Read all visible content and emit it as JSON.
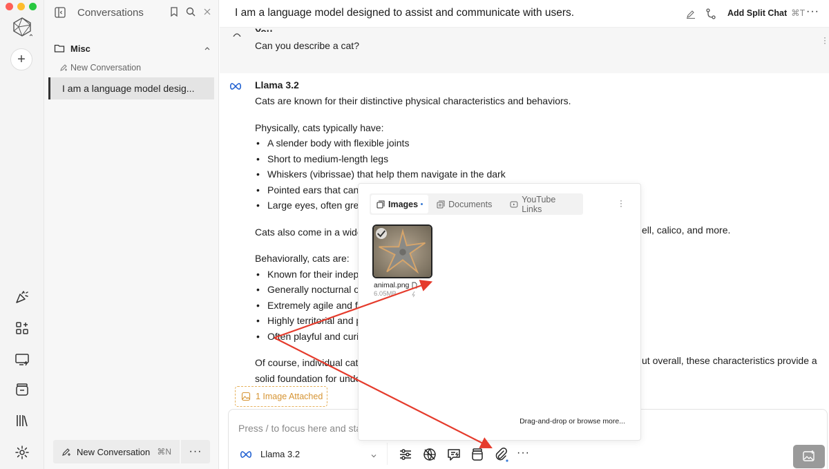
{
  "window": {
    "traffic_colors": [
      "#fe5f57",
      "#febc2e",
      "#28c840"
    ]
  },
  "sidebar": {
    "title": "Conversations",
    "folder": {
      "name": "Misc"
    },
    "new_conversation_link": "New Conversation",
    "conversations": [
      {
        "label": "I am a language model desig..."
      }
    ],
    "footer": {
      "new_button_label": "New Conversation",
      "new_button_shortcut": "⌘N"
    }
  },
  "header": {
    "title": "I am a language model designed to assist and communicate with users.",
    "split_chat_label": "Add Split Chat",
    "split_chat_shortcut": "⌘T"
  },
  "messages": {
    "user": {
      "name": "You",
      "text": "Can you describe a cat?"
    },
    "bot": {
      "name": "Llama 3.2",
      "intro": "Cats are known for their distinctive physical characteristics and behaviors.",
      "physical_heading": "Physically, cats typically have:",
      "physical_items": [
        "A slender body with flexible joints",
        "Short to medium-length legs",
        "Whiskers (vibrissae) that help them navigate in the dark",
        "Pointed ears that can",
        "Large eyes, often gree"
      ],
      "coat_start": "Cats also come in a wide",
      "coat_end": "ell, calico, and more.",
      "behavior_heading": "Behaviorally, cats are:",
      "behavior_items": [
        "Known for their indepe",
        "Generally nocturnal or",
        "Extremely agile and fle",
        "Highly territorial and p",
        "Often playful and curio"
      ],
      "closing_start": "Of course, individual cats",
      "closing_end": "ut overall, these characteristics provide a",
      "closing_line2": "solid foundation for unde"
    }
  },
  "attachment_chip": {
    "label": "1 Image Attached",
    "color": "#d69433"
  },
  "composer": {
    "placeholder": "Press / to focus here and start typing...",
    "model_name": "Llama 3.2"
  },
  "popover": {
    "tabs": [
      {
        "label": "Images",
        "active": true
      },
      {
        "label": "Documents",
        "active": false
      },
      {
        "label": "YouTube Links",
        "active": false
      }
    ],
    "file": {
      "name": "animal.png",
      "size": "6.05MB"
    },
    "footer_text": "Drag-and-drop or browse more..."
  },
  "annotation": {
    "arrow_color": "#e53b2c"
  },
  "colors": {
    "accent": "#3a7bd5",
    "brand_meta": "#1f5fd1"
  }
}
